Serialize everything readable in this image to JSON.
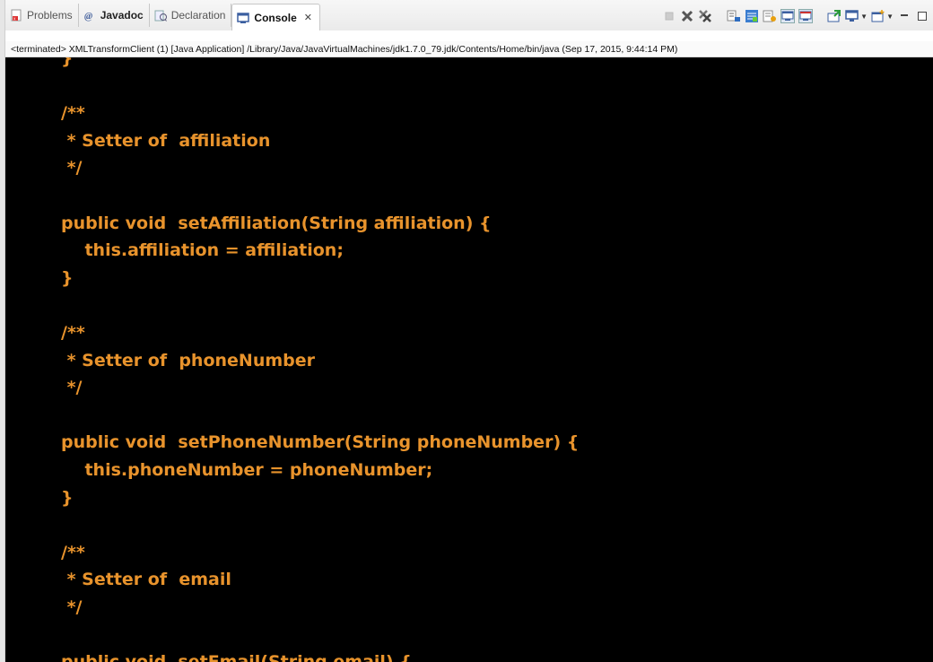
{
  "tabs": [
    {
      "label": "Problems",
      "icon": "problems-icon",
      "active": false
    },
    {
      "label": "Javadoc",
      "icon": "javadoc-icon",
      "active": false
    },
    {
      "label": "Declaration",
      "icon": "declaration-icon",
      "active": false
    },
    {
      "label": "Console",
      "icon": "console-icon",
      "active": true,
      "close": "✕"
    }
  ],
  "toolbar": {
    "icons": [
      "terminate-icon",
      "remove-launch-icon",
      "remove-all-terminated-icon",
      "scroll-lock-icon",
      "word-wrap-icon",
      "pin-console-icon",
      "show-on-stdout-icon",
      "show-on-stderr-icon",
      "open-console-icon",
      "display-selected-console-icon",
      "new-console-icon",
      "minimize-icon",
      "maximize-icon"
    ]
  },
  "status": {
    "text": "<terminated> XMLTransformClient (1) [Java Application] /Library/Java/JavaVirtualMachines/jdk1.7.0_79.jdk/Contents/Home/bin/java (Sep 17, 2015, 9:44:14 PM)"
  },
  "console": {
    "lines": [
      "}",
      "",
      "/**",
      " * Setter of  affiliation",
      " */",
      "",
      "public void  setAffiliation(String affiliation) {",
      "    this.affiliation = affiliation;",
      "}",
      "",
      "/**",
      " * Setter of  phoneNumber",
      " */",
      "",
      "public void  setPhoneNumber(String phoneNumber) {",
      "    this.phoneNumber = phoneNumber;",
      "}",
      "",
      "/**",
      " * Setter of  email",
      " */",
      "",
      "public void  setEmail(String email) {"
    ],
    "colors": {
      "background": "#000000",
      "text": "#e8932c"
    }
  }
}
